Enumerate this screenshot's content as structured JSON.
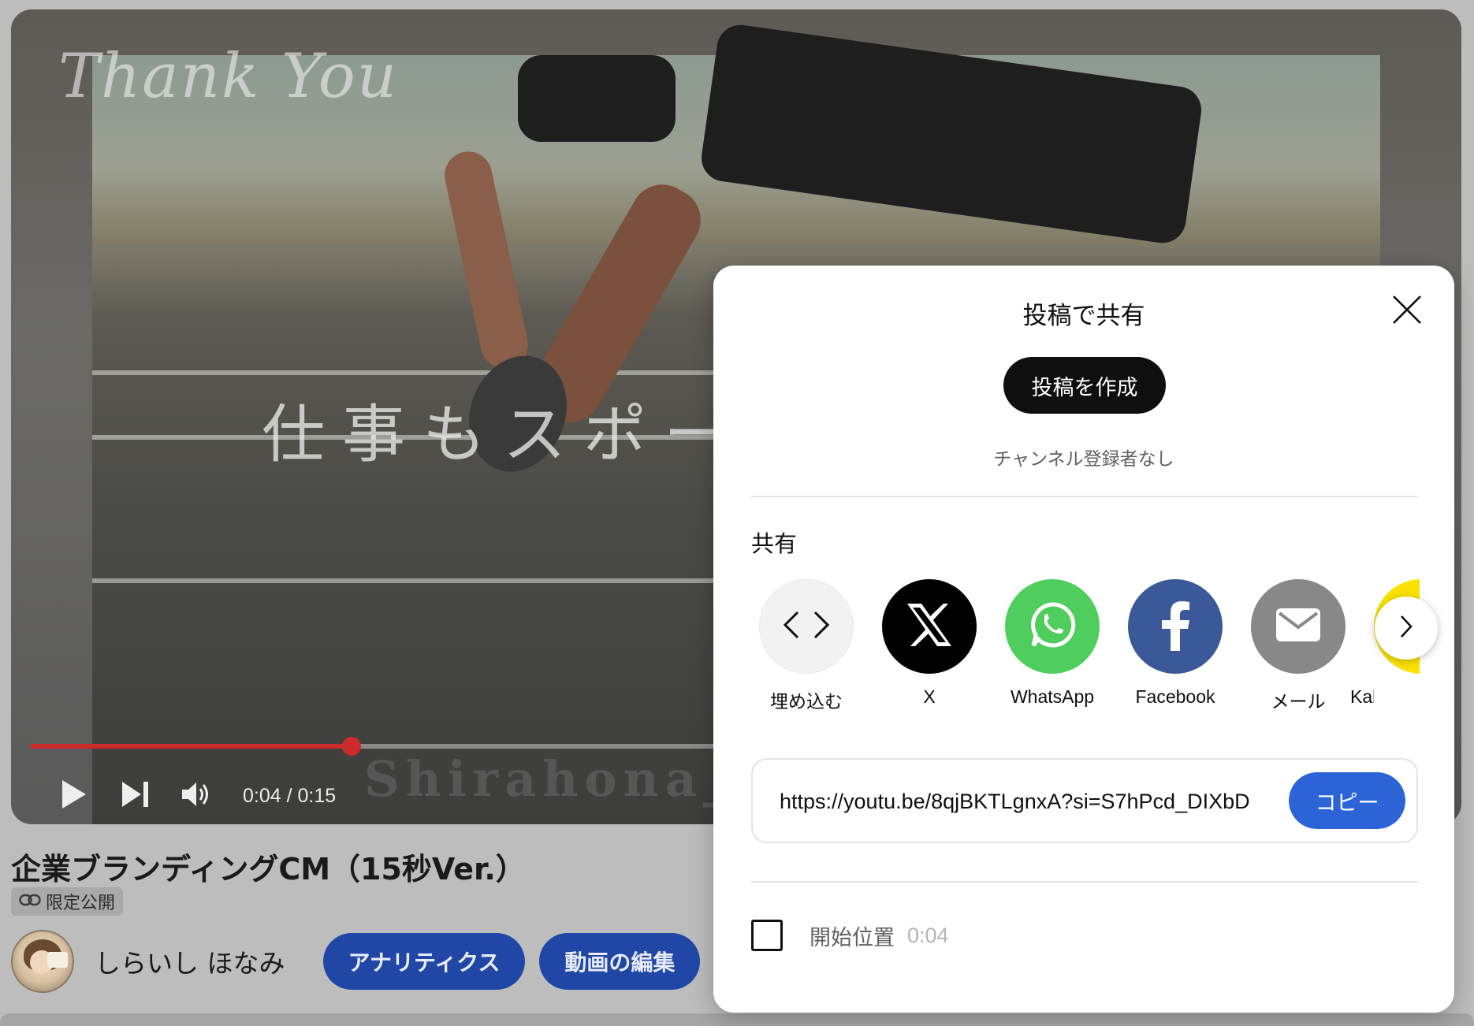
{
  "player": {
    "watermark_text": "Thank You",
    "overlay_text": "仕事もスポーツ",
    "credit_text": "Shirahona_V",
    "time_current": "0:04",
    "time_total": "0:15",
    "time_separator": " / ",
    "progress_fraction": 0.2267,
    "progress_color": "#cc2b2b"
  },
  "video": {
    "title": "企業ブランディングCM（15秒Ver.）",
    "visibility": "限定公開"
  },
  "channel": {
    "name": "しらいし ほなみ",
    "analytics_label": "アナリティクス",
    "edit_label": "動画の編集",
    "button_color": "#2147a6"
  },
  "dialog": {
    "title": "投稿で共有",
    "create_post_label": "投稿を作成",
    "no_subscribers": "チャンネル登録者なし",
    "share_heading": "共有",
    "share_targets": [
      {
        "label": "埋め込む",
        "icon": "embed-code-icon",
        "color": "#f2f2f2"
      },
      {
        "label": "X",
        "icon": "x-logo-icon",
        "color": "#000000"
      },
      {
        "label": "WhatsApp",
        "icon": "whatsapp-icon",
        "color": "#4fce5d"
      },
      {
        "label": "Facebook",
        "icon": "facebook-icon",
        "color": "#3b5998"
      },
      {
        "label": "メール",
        "icon": "mail-icon",
        "color": "#888888"
      },
      {
        "label": "Kaka",
        "icon": "kakaotalk-icon",
        "color": "#fae100"
      }
    ],
    "url": "https://youtu.be/8qjBKTLgnxA?si=S7hPcd_DIXbD",
    "copy_label": "コピー",
    "copy_color": "#2c64d8",
    "start_label": "開始位置",
    "start_time": "0:04"
  }
}
